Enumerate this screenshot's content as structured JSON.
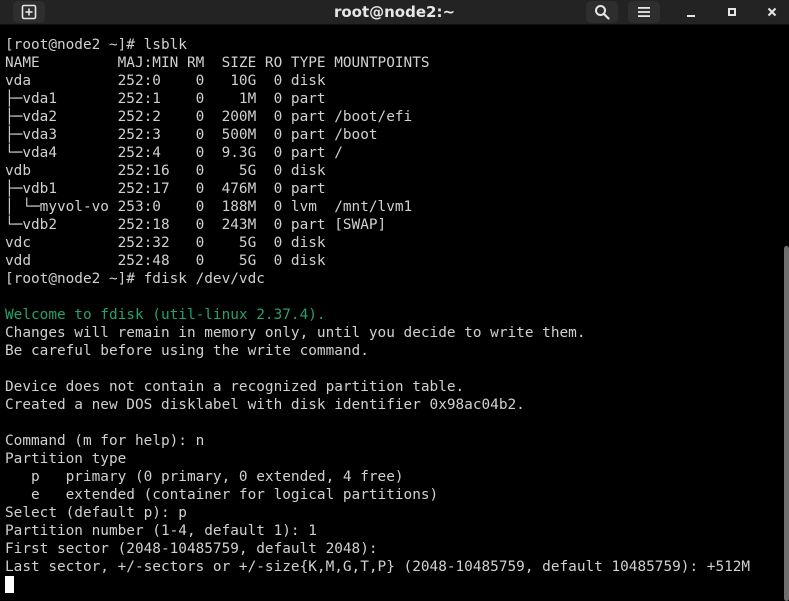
{
  "window": {
    "title": "root@node2:~"
  },
  "icons": {
    "new_tab": "new-tab-icon",
    "search": "search-icon",
    "menu": "hamburger-menu-icon",
    "minimize": "minimize-icon",
    "maximize": "maximize-icon",
    "close": "close-icon"
  },
  "colors": {
    "background": "#000000",
    "text": "#d0d0d0",
    "welcome_green": "#26a269",
    "titlebar": "#232323"
  },
  "terminal": {
    "lines": [
      {
        "text": "[root@node2 ~]# lsblk",
        "color": ""
      },
      {
        "text": "NAME         MAJ:MIN RM  SIZE RO TYPE MOUNTPOINTS",
        "color": ""
      },
      {
        "text": "vda          252:0    0   10G  0 disk",
        "color": ""
      },
      {
        "text": "├─vda1       252:1    0    1M  0 part",
        "color": ""
      },
      {
        "text": "├─vda2       252:2    0  200M  0 part /boot/efi",
        "color": ""
      },
      {
        "text": "├─vda3       252:3    0  500M  0 part /boot",
        "color": ""
      },
      {
        "text": "└─vda4       252:4    0  9.3G  0 part /",
        "color": ""
      },
      {
        "text": "vdb          252:16   0    5G  0 disk",
        "color": ""
      },
      {
        "text": "├─vdb1       252:17   0  476M  0 part",
        "color": ""
      },
      {
        "text": "│ └─myvol-vo 253:0    0  188M  0 lvm  /mnt/lvm1",
        "color": ""
      },
      {
        "text": "└─vdb2       252:18   0  243M  0 part [SWAP]",
        "color": ""
      },
      {
        "text": "vdc          252:32   0    5G  0 disk",
        "color": ""
      },
      {
        "text": "vdd          252:48   0    5G  0 disk",
        "color": ""
      },
      {
        "text": "[root@node2 ~]# fdisk /dev/vdc",
        "color": ""
      },
      {
        "text": "",
        "color": ""
      },
      {
        "text": "Welcome to fdisk (util-linux 2.37.4).",
        "color": "green"
      },
      {
        "text": "Changes will remain in memory only, until you decide to write them.",
        "color": ""
      },
      {
        "text": "Be careful before using the write command.",
        "color": ""
      },
      {
        "text": "",
        "color": ""
      },
      {
        "text": "Device does not contain a recognized partition table.",
        "color": ""
      },
      {
        "text": "Created a new DOS disklabel with disk identifier 0x98ac04b2.",
        "color": ""
      },
      {
        "text": "",
        "color": ""
      },
      {
        "text": "Command (m for help): n",
        "color": ""
      },
      {
        "text": "Partition type",
        "color": ""
      },
      {
        "text": "   p   primary (0 primary, 0 extended, 4 free)",
        "color": ""
      },
      {
        "text": "   e   extended (container for logical partitions)",
        "color": ""
      },
      {
        "text": "Select (default p): p",
        "color": ""
      },
      {
        "text": "Partition number (1-4, default 1): 1",
        "color": ""
      },
      {
        "text": "First sector (2048-10485759, default 2048):",
        "color": ""
      },
      {
        "text": "Last sector, +/-sectors or +/-size{K,M,G,T,P} (2048-10485759, default 10485759): +512M",
        "color": ""
      }
    ]
  }
}
